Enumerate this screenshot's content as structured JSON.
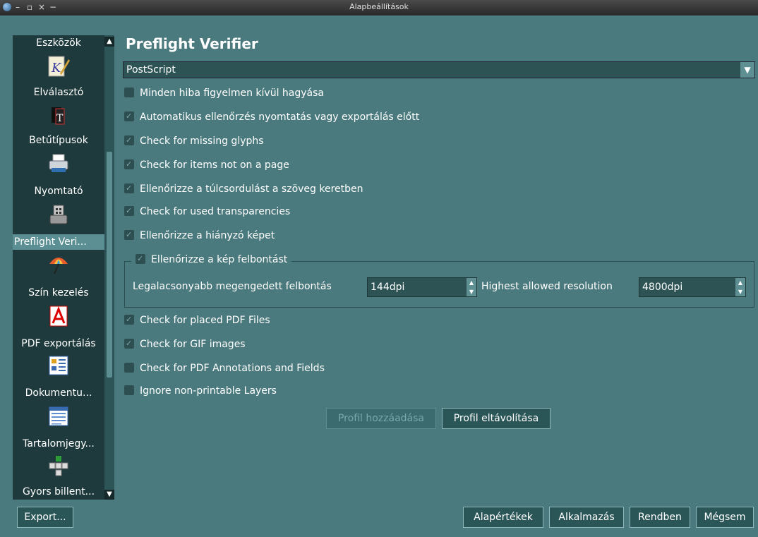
{
  "window": {
    "title": "Alapbeállítások",
    "controls": [
      "–",
      "▫",
      "×",
      "−"
    ]
  },
  "sidebar": {
    "items": [
      {
        "label": "Eszközök"
      },
      {
        "label": "Elválasztó"
      },
      {
        "label": "Betűtípusok"
      },
      {
        "label": "Nyomtató"
      },
      {
        "label": "Preflight Veri..."
      },
      {
        "label": "Szín kezelés"
      },
      {
        "label": "PDF exportálás"
      },
      {
        "label": "Dokumentu..."
      },
      {
        "label": "Tartalomjegy..."
      },
      {
        "label": "Gyors billent..."
      }
    ],
    "selected": "Preflight Veri..."
  },
  "main": {
    "title": "Preflight Verifier",
    "profile_select": "PostScript",
    "checks": [
      {
        "label": "Minden hiba figyelmen kívül hagyása",
        "checked": false
      },
      {
        "label": "Automatikus ellenőrzés nyomtatás vagy exportálás előtt",
        "checked": true
      },
      {
        "label": "Check for missing glyphs",
        "checked": true
      },
      {
        "label": "Check for items not on a page",
        "checked": true
      },
      {
        "label": "Ellenőrizze a túlcsordulást a szöveg keretben",
        "checked": true
      },
      {
        "label": "Check for used transparencies",
        "checked": true
      },
      {
        "label": "Ellenőrizze a hiányzó képet",
        "checked": true
      }
    ],
    "resolution_group": {
      "title": "Ellenőrizze a kép felbontást",
      "checked": true,
      "min_label": "Legalacsonyabb megengedett felbontás",
      "min_value": "144dpi",
      "max_label": "Highest allowed resolution",
      "max_value": "4800dpi"
    },
    "checks2": [
      {
        "label": "Check for placed PDF Files",
        "checked": true
      },
      {
        "label": "Check for GIF images",
        "checked": true
      },
      {
        "label": "Check for PDF Annotations and Fields",
        "checked": false
      },
      {
        "label": "Ignore non-printable Layers",
        "checked": false
      }
    ],
    "add_profile": "Profil hozzáadása",
    "remove_profile": "Profil eltávolítása"
  },
  "footer": {
    "export": "Export...",
    "defaults": "Alapértékek",
    "apply": "Alkalmazás",
    "ok": "Rendben",
    "cancel": "Mégsem"
  }
}
